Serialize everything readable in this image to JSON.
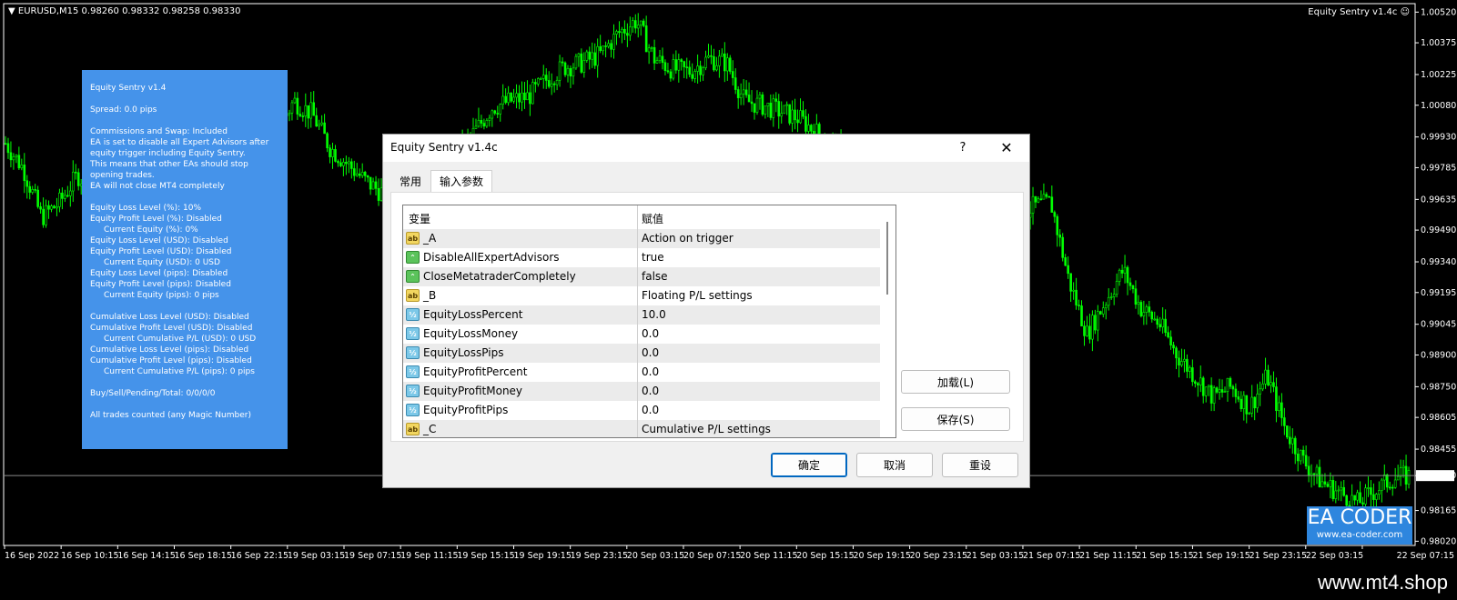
{
  "chart_header": {
    "symbol_info": "EURUSD,M15  0.98260 0.98332 0.98258 0.98330",
    "ea_name": "Equity Sentry v1.4c",
    "ea_status_icon": "smiley-icon"
  },
  "chart_data": {
    "type": "candlestick",
    "price_levels": [
      "1.00520",
      "1.00375",
      "1.00225",
      "1.00080",
      "0.99930",
      "0.99785",
      "0.99635",
      "0.99490",
      "0.99340",
      "0.99195",
      "0.99045",
      "0.98900",
      "0.98750",
      "0.98605",
      "0.98455",
      "0.98330",
      "0.98165",
      "0.98020"
    ],
    "current_price": "0.98330",
    "time_labels": [
      "16 Sep 2022",
      "16 Sep 10:15",
      "16 Sep 14:15",
      "16 Sep 18:15",
      "16 Sep 22:15",
      "19 Sep 03:15",
      "19 Sep 07:15",
      "19 Sep 11:15",
      "19 Sep 15:15",
      "19 Sep 19:15",
      "19 Sep 23:15",
      "20 Sep 03:15",
      "20 Sep 07:15",
      "20 Sep 11:15",
      "20 Sep 15:15",
      "20 Sep 19:15",
      "20 Sep 23:15",
      "21 Sep 03:15",
      "21 Sep 07:15",
      "21 Sep 11:15",
      "21 Sep 15:15",
      "21 Sep 19:15",
      "21 Sep 23:15",
      "22 Sep 03:15",
      "22 Sep 07:15"
    ],
    "close_path": [
      [
        0,
        0.999
      ],
      [
        20,
        0.9978
      ],
      [
        40,
        0.9955
      ],
      [
        60,
        0.9962
      ],
      [
        80,
        0.9975
      ],
      [
        100,
        0.9968
      ],
      [
        120,
        0.9985
      ],
      [
        140,
        0.9992
      ],
      [
        160,
        1.0003
      ],
      [
        180,
        1.0005
      ],
      [
        200,
        1.0
      ],
      [
        220,
        0.9996
      ],
      [
        240,
        0.9993
      ],
      [
        260,
        0.9991
      ],
      [
        280,
        0.9986
      ],
      [
        300,
        0.9995
      ],
      [
        320,
        1.001
      ],
      [
        340,
        1.0004
      ],
      [
        360,
        0.9988
      ],
      [
        380,
        0.998
      ],
      [
        400,
        0.9972
      ],
      [
        420,
        0.9966
      ],
      [
        440,
        0.996
      ],
      [
        460,
        0.9965
      ],
      [
        480,
        0.9974
      ],
      [
        500,
        0.9985
      ],
      [
        520,
        0.9995
      ],
      [
        540,
        1.0007
      ],
      [
        560,
        1.001
      ],
      [
        580,
        1.0012
      ],
      [
        600,
        1.002
      ],
      [
        620,
        1.0026
      ],
      [
        640,
        1.0028
      ],
      [
        660,
        1.0032
      ],
      [
        680,
        1.0042
      ],
      [
        700,
        1.0048
      ],
      [
        720,
        1.003
      ],
      [
        740,
        1.0025
      ],
      [
        760,
        1.0024
      ],
      [
        780,
        1.003
      ],
      [
        800,
        1.0028
      ],
      [
        820,
        1.001
      ],
      [
        840,
        1.0008
      ],
      [
        860,
        1.0005
      ],
      [
        880,
        1.0002
      ],
      [
        900,
        0.9995
      ],
      [
        920,
        0.9988
      ],
      [
        940,
        0.998
      ],
      [
        960,
        0.9975
      ],
      [
        980,
        0.9968
      ],
      [
        1000,
        0.9972
      ],
      [
        1020,
        0.9965
      ],
      [
        1040,
        0.997
      ],
      [
        1060,
        0.996
      ],
      [
        1080,
        0.9952
      ],
      [
        1100,
        0.9948
      ],
      [
        1120,
        0.9955
      ],
      [
        1140,
        0.996
      ],
      [
        1160,
        0.9962
      ],
      [
        1180,
        0.9925
      ],
      [
        1200,
        0.99
      ],
      [
        1220,
        0.9915
      ],
      [
        1240,
        0.993
      ],
      [
        1260,
        0.9912
      ],
      [
        1280,
        0.9905
      ],
      [
        1300,
        0.989
      ],
      [
        1320,
        0.988
      ],
      [
        1340,
        0.987
      ],
      [
        1360,
        0.9875
      ],
      [
        1380,
        0.9865
      ],
      [
        1400,
        0.988
      ],
      [
        1420,
        0.9855
      ],
      [
        1440,
        0.984
      ],
      [
        1460,
        0.983
      ],
      [
        1480,
        0.9825
      ],
      [
        1500,
        0.982
      ],
      [
        1520,
        0.9826
      ],
      [
        1540,
        0.9832
      ],
      [
        1560,
        0.9833
      ]
    ]
  },
  "info_panel": {
    "lines": [
      {
        "text": "Equity Sentry v1.4",
        "indent": false
      },
      {
        "gap": true
      },
      {
        "text": "Spread: 0.0 pips",
        "indent": false
      },
      {
        "gap": true
      },
      {
        "text": "Commissions and Swap: Included",
        "indent": false
      },
      {
        "text": "EA is set to disable all Expert Advisors after",
        "indent": false
      },
      {
        "text": "equity trigger including Equity Sentry.",
        "indent": false
      },
      {
        "text": "This means that other EAs should stop",
        "indent": false
      },
      {
        "text": "opening trades.",
        "indent": false
      },
      {
        "text": "EA will not close MT4 completely",
        "indent": false
      },
      {
        "gap": true
      },
      {
        "text": "Equity Loss Level (%): 10%",
        "indent": false
      },
      {
        "text": "Equity Profit Level (%): Disabled",
        "indent": false
      },
      {
        "text": "Current Equity (%): 0%",
        "indent": true
      },
      {
        "text": "Equity Loss Level (USD): Disabled",
        "indent": false
      },
      {
        "text": "Equity Profit Level (USD): Disabled",
        "indent": false
      },
      {
        "text": "Current Equity (USD): 0 USD",
        "indent": true
      },
      {
        "text": "Equity Loss Level (pips): Disabled",
        "indent": false
      },
      {
        "text": "Equity Profit Level (pips): Disabled",
        "indent": false
      },
      {
        "text": "Current Equity (pips): 0 pips",
        "indent": true
      },
      {
        "gap": true
      },
      {
        "text": "Cumulative Loss Level (USD): Disabled",
        "indent": false
      },
      {
        "text": "Cumulative Profit Level (USD): Disabled",
        "indent": false
      },
      {
        "text": "Current Cumulative P/L (USD): 0 USD",
        "indent": true
      },
      {
        "text": "Cumulative Loss Level (pips): Disabled",
        "indent": false
      },
      {
        "text": "Cumulative Profit Level (pips): Disabled",
        "indent": false
      },
      {
        "text": "Current Cumulative P/L (pips): 0 pips",
        "indent": true
      },
      {
        "gap": true
      },
      {
        "text": "Buy/Sell/Pending/Total: 0/0/0/0",
        "indent": false
      },
      {
        "gap": true
      },
      {
        "text": "All trades counted (any Magic Number)",
        "indent": false
      }
    ]
  },
  "dialog": {
    "title": "Equity Sentry v1.4c",
    "help_label": "?",
    "close_label": "✕",
    "tabs": [
      {
        "label": "常用",
        "active": false
      },
      {
        "label": "输入参数",
        "active": true
      }
    ],
    "columns": {
      "variable": "变量",
      "value": "赋值"
    },
    "rows": [
      {
        "icon": "ab",
        "name": "_A",
        "value": "Action on trigger"
      },
      {
        "icon": "bool",
        "name": "DisableAllExpertAdvisors",
        "value": "true"
      },
      {
        "icon": "bool",
        "name": "CloseMetatraderCompletely",
        "value": "false"
      },
      {
        "icon": "ab",
        "name": "_B",
        "value": "Floating P/L settings"
      },
      {
        "icon": "num",
        "name": "EquityLossPercent",
        "value": "10.0"
      },
      {
        "icon": "num",
        "name": "EquityLossMoney",
        "value": "0.0"
      },
      {
        "icon": "num",
        "name": "EquityLossPips",
        "value": "0.0"
      },
      {
        "icon": "num",
        "name": "EquityProfitPercent",
        "value": "0.0"
      },
      {
        "icon": "num",
        "name": "EquityProfitMoney",
        "value": "0.0"
      },
      {
        "icon": "num",
        "name": "EquityProfitPips",
        "value": "0.0"
      },
      {
        "icon": "ab",
        "name": "_C",
        "value": "Cumulative P/L settings"
      }
    ],
    "load_label": "加载(L)",
    "save_label": "保存(S)",
    "ok_label": "确定",
    "cancel_label": "取消",
    "reset_label": "重设"
  },
  "logo": {
    "title": "EA CODER",
    "url": "www.ea-coder.com"
  },
  "footer": {
    "site": "www.mt4.shop"
  },
  "colors": {
    "candle": "#00FF00",
    "panel": "#4593EA",
    "background": "#000000",
    "axis": "#FFFFFF"
  }
}
